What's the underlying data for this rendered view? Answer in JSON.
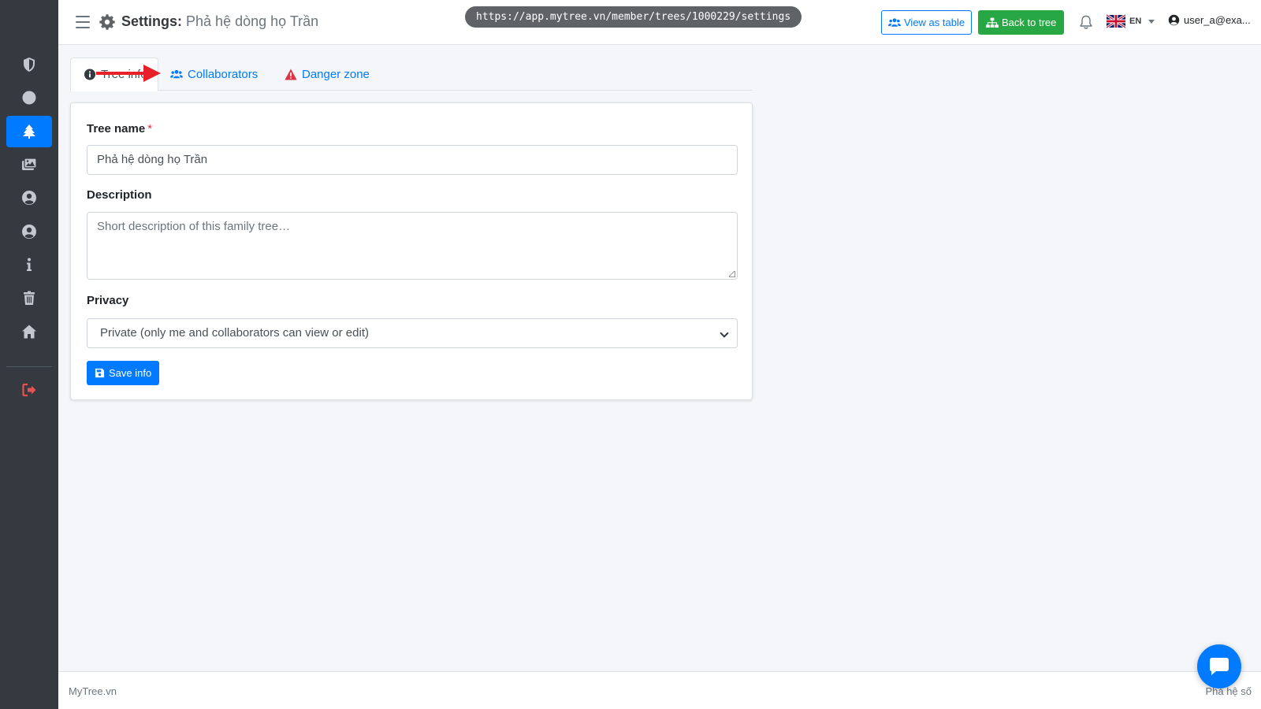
{
  "header": {
    "title_prefix": "Settings:",
    "title_name": "Phả hệ dòng họ Trần",
    "url": "https://app.mytree.vn/member/trees/1000229/settings",
    "view_table_label": "View as table",
    "back_tree_label": "Back to tree",
    "lang": "EN",
    "user": "user_a@exa..."
  },
  "sidebar": {
    "items": [
      {
        "icon": "shield-icon"
      },
      {
        "icon": "circle-icon"
      },
      {
        "icon": "tree-icon",
        "active": true
      },
      {
        "icon": "images-icon"
      },
      {
        "icon": "user-circle-icon"
      },
      {
        "icon": "user-circle-icon"
      },
      {
        "icon": "info-icon"
      },
      {
        "icon": "trash-icon"
      },
      {
        "icon": "home-icon"
      },
      {
        "icon": "sign-out-icon"
      }
    ]
  },
  "tabs": [
    {
      "label": "Tree info",
      "icon": "info-circle-icon",
      "active": true
    },
    {
      "label": "Collaborators",
      "icon": "users-icon"
    },
    {
      "label": "Danger zone",
      "icon": "warning-icon"
    }
  ],
  "form": {
    "name_label": "Tree name",
    "required_mark": "*",
    "name_value": "Phả hệ dòng họ Trần",
    "desc_label": "Description",
    "desc_placeholder": "Short description of this family tree…",
    "privacy_label": "Privacy",
    "privacy_value": "Private (only me and collaborators can view or edit)",
    "save_label": "Save info"
  },
  "footer": {
    "left": "MyTree.vn",
    "right": "Phả hệ số"
  },
  "colors": {
    "sidebar": "#343a40",
    "primary": "#007bff",
    "success": "#28a745",
    "danger": "#dc3545",
    "annotation_arrow": "#e8202a"
  }
}
